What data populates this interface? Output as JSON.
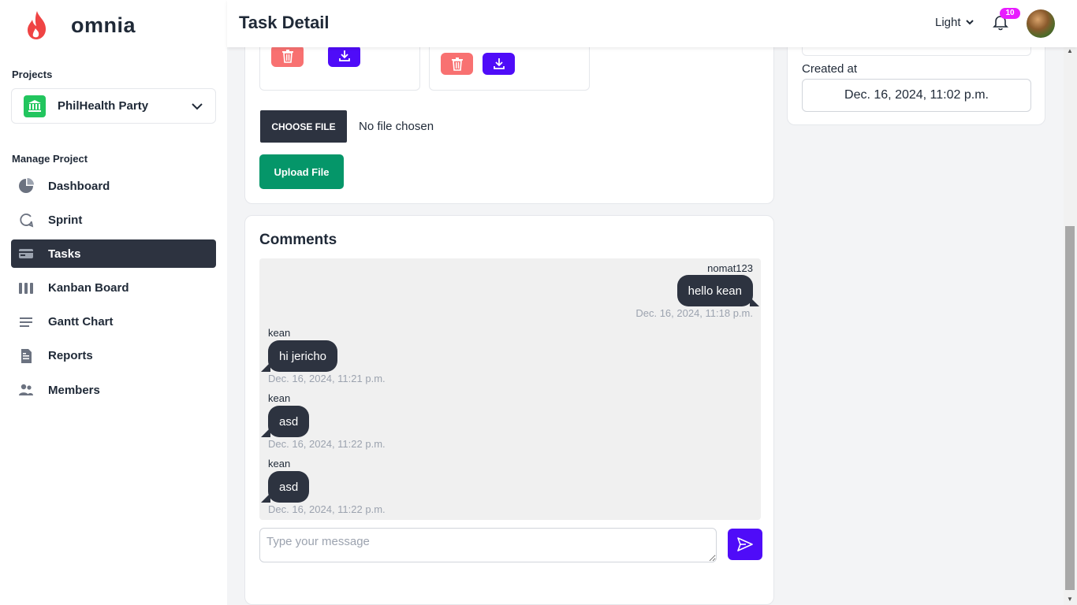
{
  "brand": {
    "name": "omnia",
    "logo_icon": "flame-icon",
    "logo_color": "#ef4444"
  },
  "sidebar": {
    "projects_label": "Projects",
    "project_select": {
      "value": "PhilHealth Party",
      "icon": "bank-icon"
    },
    "manage_label": "Manage Project",
    "items": [
      {
        "label": "Dashboard",
        "icon": "pie-chart-icon",
        "active": false
      },
      {
        "label": "Sprint",
        "icon": "sprint-cycle-icon",
        "active": false
      },
      {
        "label": "Tasks",
        "icon": "tasks-card-icon",
        "active": true
      },
      {
        "label": "Kanban Board",
        "icon": "kanban-columns-icon",
        "active": false
      },
      {
        "label": "Gantt Chart",
        "icon": "gantt-lines-icon",
        "active": false
      },
      {
        "label": "Reports",
        "icon": "report-document-icon",
        "active": false
      },
      {
        "label": "Members",
        "icon": "members-group-icon",
        "active": false
      }
    ]
  },
  "header": {
    "title": "Task Detail",
    "theme": "Light",
    "notifications_count": "10"
  },
  "attachments": {
    "choose_file_label": "CHOOSE FILE",
    "no_file_text": "No file chosen",
    "upload_label": "Upload File"
  },
  "meta": {
    "created_at_label": "Created at",
    "created_at_value": "Dec. 16, 2024, 11:02 p.m."
  },
  "comments": {
    "title": "Comments",
    "messages": [
      {
        "author": "nomat123",
        "text": "hello kean",
        "time": "Dec. 16, 2024, 11:18 p.m.",
        "side": "right"
      },
      {
        "author": "kean",
        "text": "hi jericho",
        "time": "Dec. 16, 2024, 11:21 p.m.",
        "side": "left"
      },
      {
        "author": "kean",
        "text": "asd",
        "time": "Dec. 16, 2024, 11:22 p.m.",
        "side": "left"
      },
      {
        "author": "kean",
        "text": "asd",
        "time": "Dec. 16, 2024, 11:22 p.m.",
        "side": "left"
      }
    ],
    "input_placeholder": "Type your message"
  },
  "colors": {
    "primary_dark": "#2d3340",
    "accent_purple": "#4f0cf8",
    "delete_red": "#f87171",
    "upload_green": "#059669",
    "badge_magenta": "#e81cff"
  }
}
